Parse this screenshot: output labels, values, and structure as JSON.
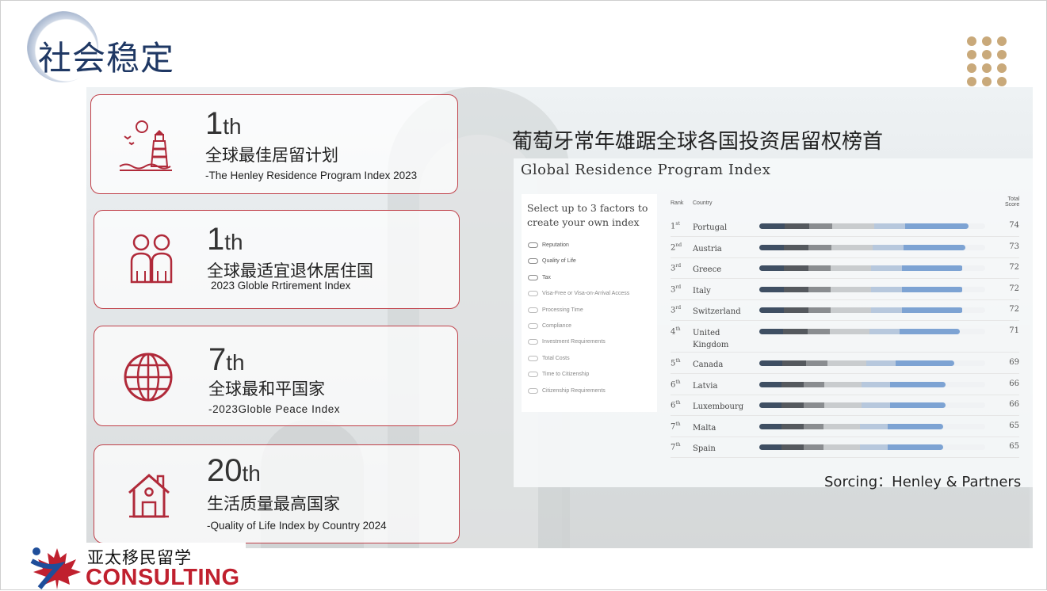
{
  "page": {
    "title": "社会稳定"
  },
  "cards": [
    {
      "icon": "lighthouse-icon",
      "rank_num": "1",
      "rank_suffix": "th",
      "cn": "全球最佳居留计划",
      "en": "-The Henley Residence Program Index 2023"
    },
    {
      "icon": "people-icon",
      "rank_num": "1",
      "rank_suffix": "th",
      "cn": "全球最适宜退休居住国",
      "en": "2023 Globle Rrtirement Index"
    },
    {
      "icon": "globe-icon",
      "rank_num": "7",
      "rank_suffix": "th",
      "cn": "全球最和平国家",
      "en": "-2023Globle Peace Index"
    },
    {
      "icon": "house-icon",
      "rank_num": "20",
      "rank_suffix": "th",
      "cn": "生活质量最高国家",
      "en": "-Quality of Life Index by Country 2024"
    }
  ],
  "index_panel": {
    "heading": "葡萄牙常年雄踞全球各国投资居留权榜首",
    "title": "Global Residence Program Index",
    "factor_prompt": "Select up to 3 factors to create your own index",
    "factors": [
      {
        "label": "Reputation",
        "enabled": true
      },
      {
        "label": "Quality of Life",
        "enabled": true
      },
      {
        "label": "Tax",
        "enabled": true
      },
      {
        "label": "Visa-Free or Visa-on-Arrival Access",
        "enabled": false
      },
      {
        "label": "Processing Time",
        "enabled": false
      },
      {
        "label": "Compliance",
        "enabled": false
      },
      {
        "label": "Investment Requirements",
        "enabled": false
      },
      {
        "label": "Total Costs",
        "enabled": false
      },
      {
        "label": "Time to Citizenship",
        "enabled": false
      },
      {
        "label": "Citizenship Requirements",
        "enabled": false
      }
    ],
    "headers": {
      "rank": "Rank",
      "country": "Country",
      "score_line1": "Total",
      "score_line2": "Score"
    },
    "colors": {
      "dark": "#3f4f63",
      "mid": "#55595e",
      "grey": "#8a8d90",
      "light_grey": "#c9ccce",
      "pale_blue": "#b7c8dd",
      "blue": "#7da3d3"
    },
    "rows": [
      {
        "rank": "1",
        "sup": "st",
        "country": "Portugal",
        "country2": "",
        "score": "74"
      },
      {
        "rank": "2",
        "sup": "nd",
        "country": "Austria",
        "country2": "",
        "score": "73"
      },
      {
        "rank": "3",
        "sup": "rd",
        "country": "Greece",
        "country2": "",
        "score": "72"
      },
      {
        "rank": "3",
        "sup": "rd",
        "country": "Italy",
        "country2": "",
        "score": "72"
      },
      {
        "rank": "3",
        "sup": "rd",
        "country": "Switzerland",
        "country2": "",
        "score": "72"
      },
      {
        "rank": "4",
        "sup": "th",
        "country": "United",
        "country2": "Kingdom",
        "score": "71"
      },
      {
        "rank": "5",
        "sup": "th",
        "country": "Canada",
        "country2": "",
        "score": "69"
      },
      {
        "rank": "6",
        "sup": "th",
        "country": "Latvia",
        "country2": "",
        "score": "66"
      },
      {
        "rank": "6",
        "sup": "th",
        "country": "Luxembourg",
        "country2": "",
        "score": "66"
      },
      {
        "rank": "7",
        "sup": "th",
        "country": "Malta",
        "country2": "",
        "score": "65"
      },
      {
        "rank": "7",
        "sup": "th",
        "country": "Spain",
        "country2": "",
        "score": "65"
      }
    ],
    "source": "Sorcing：Henley & Partners"
  },
  "logo": {
    "cn": "亚太移民留学",
    "en": "CONSULTING"
  }
}
